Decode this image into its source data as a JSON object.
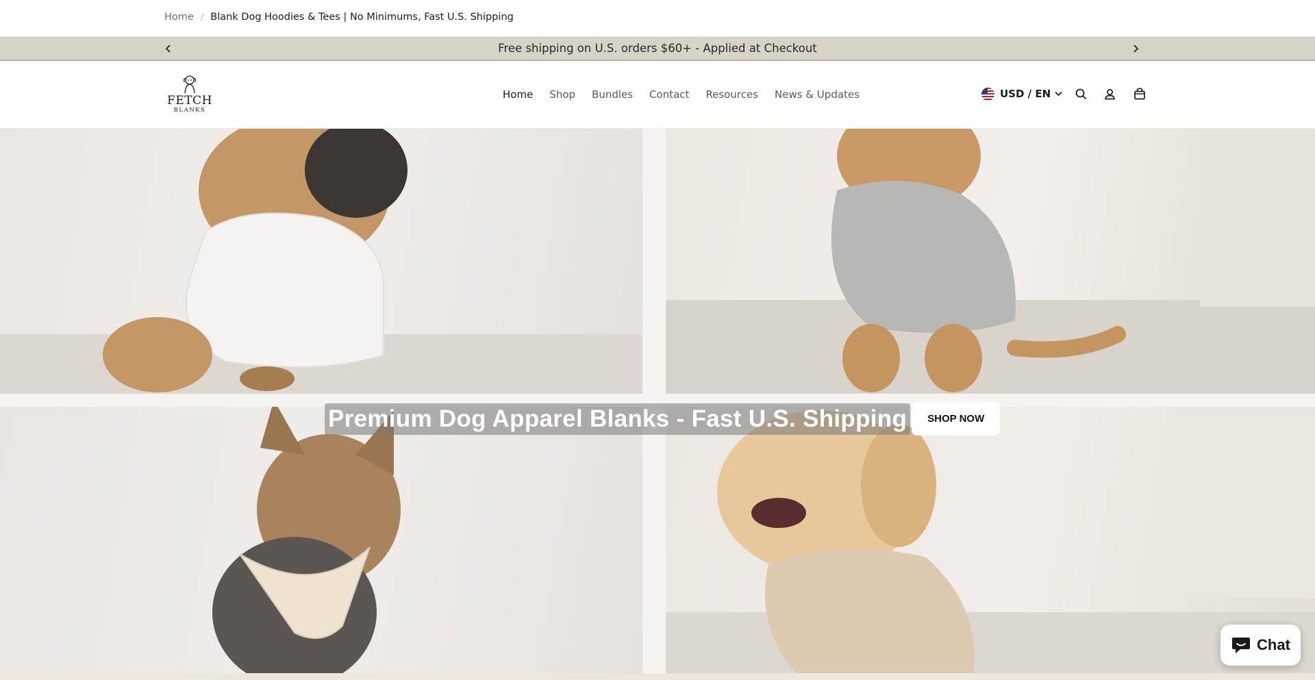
{
  "breadcrumb": {
    "home": "Home",
    "separator": "/",
    "current": "Blank Dog Hoodies & Tees | No Minimums, Fast U.S. Shipping"
  },
  "announcement": {
    "message": "Free shipping on U.S. orders $60+ - Applied at Checkout",
    "prev_icon": "chevron-left-icon",
    "next_icon": "chevron-right-icon",
    "background": "#d9d2c9"
  },
  "header": {
    "logo": {
      "line1": "FETCH",
      "line2": "BLANKS"
    },
    "nav": [
      {
        "label": "Home",
        "active": true
      },
      {
        "label": "Shop",
        "active": false
      },
      {
        "label": "Bundles",
        "active": false
      },
      {
        "label": "Contact",
        "active": false
      },
      {
        "label": "Resources",
        "active": false
      },
      {
        "label": "News & Updates",
        "active": false
      }
    ],
    "currency_label": "USD / EN",
    "icons": [
      "us-flag-icon",
      "chevron-down-icon",
      "search-icon",
      "account-icon",
      "cart-icon"
    ]
  },
  "hero": {
    "title": "Premium Dog Apparel Blanks - Fast U.S. Shipping",
    "cta_label": "SHOP NOW",
    "panels": [
      "pug-white-tee-photo",
      "poodle-grey-hoodie-photo",
      "yorkie-cream-bandana-photo",
      "golden-retriever-tan-sweater-photo"
    ]
  },
  "chat": {
    "label": "Chat",
    "icon": "chat-bubble-icon"
  }
}
